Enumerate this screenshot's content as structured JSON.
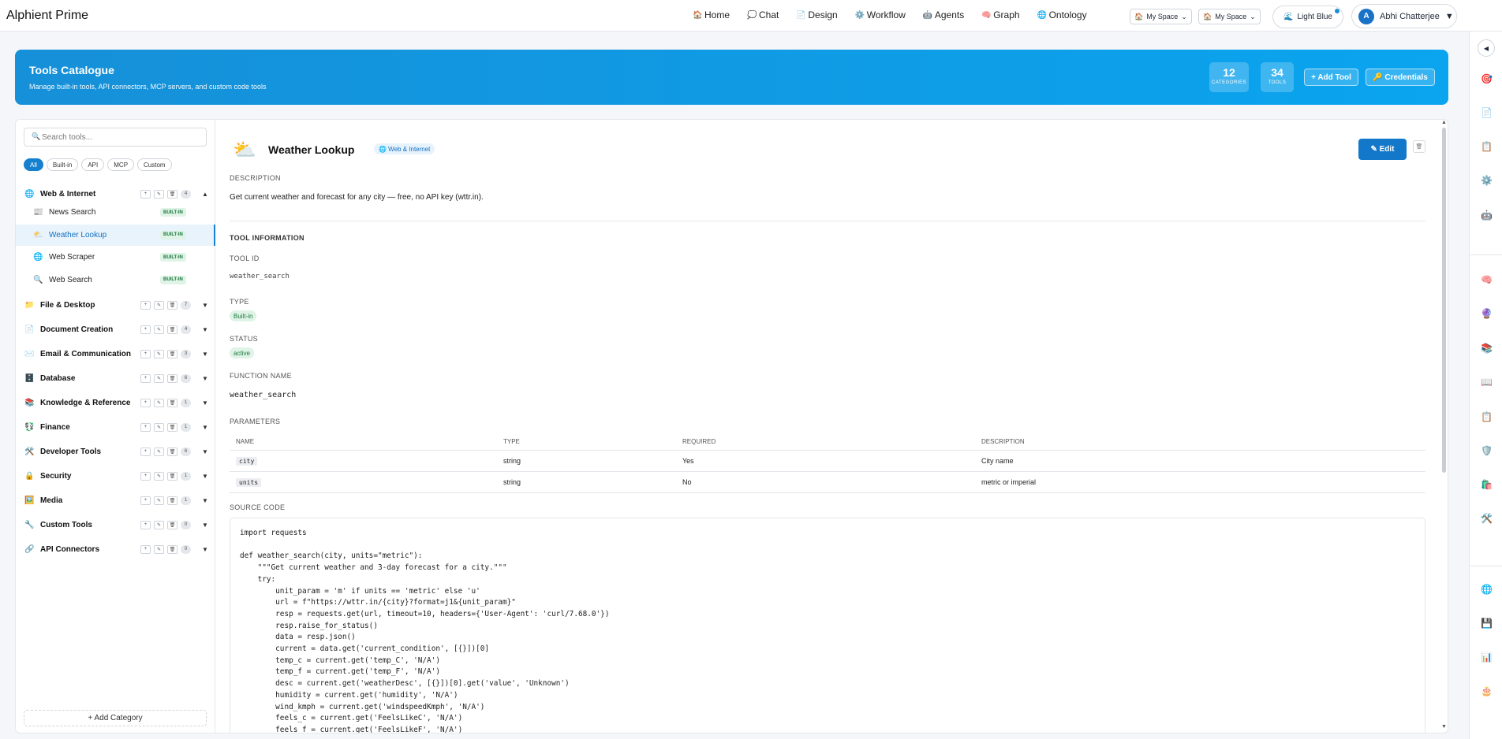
{
  "app": {
    "title": "Alphient Prime"
  },
  "nav": [
    {
      "icon": "🏠",
      "label": "Home"
    },
    {
      "icon": "💭",
      "label": "Chat"
    },
    {
      "icon": "📄",
      "label": "Design"
    },
    {
      "icon": "⚙️",
      "label": "Workflow"
    },
    {
      "icon": "🤖",
      "label": "Agents"
    },
    {
      "icon": "🧠",
      "label": "Graph"
    },
    {
      "icon": "🌐",
      "label": "Ontology"
    }
  ],
  "spaces": [
    {
      "label": "My Space"
    },
    {
      "label": "My Space"
    }
  ],
  "theme": {
    "label": "Light Blue"
  },
  "user": {
    "initial": "A",
    "name": "Abhi Chatterjee"
  },
  "header": {
    "title": "Tools Catalogue",
    "subtitle": "Manage built-in tools, API connectors, MCP servers, and custom code tools",
    "stats": [
      {
        "value": "12",
        "label": "CATEGORIES"
      },
      {
        "value": "34",
        "label": "TOOLS"
      }
    ],
    "add_tool": "+ Add Tool",
    "credentials": "🔑 Credentials"
  },
  "sidebar": {
    "search_placeholder": "Search tools...",
    "filters": [
      "All",
      "Built-in",
      "API",
      "MCP",
      "Custom"
    ],
    "categories": [
      {
        "icon": "🌐",
        "name": "Web & Internet",
        "count": "4",
        "expanded": true,
        "tools": [
          {
            "icon": "📰",
            "name": "News Search",
            "badge": "BUILT-IN"
          },
          {
            "icon": "⛅",
            "name": "Weather Lookup",
            "badge": "BUILT-IN"
          },
          {
            "icon": "🌐",
            "name": "Web Scraper",
            "badge": "BUILT-IN"
          },
          {
            "icon": "🔍",
            "name": "Web Search",
            "badge": "BUILT-IN"
          }
        ]
      },
      {
        "icon": "📁",
        "name": "File & Desktop",
        "count": "7"
      },
      {
        "icon": "📄",
        "name": "Document Creation",
        "count": "4"
      },
      {
        "icon": "✉️",
        "name": "Email & Communication",
        "count": "3"
      },
      {
        "icon": "🗄️",
        "name": "Database",
        "count": "6"
      },
      {
        "icon": "📚",
        "name": "Knowledge & Reference",
        "count": "1"
      },
      {
        "icon": "💱",
        "name": "Finance",
        "count": "1"
      },
      {
        "icon": "🛠️",
        "name": "Developer Tools",
        "count": "6"
      },
      {
        "icon": "🔒",
        "name": "Security",
        "count": "1"
      },
      {
        "icon": "🖼️",
        "name": "Media",
        "count": "1"
      },
      {
        "icon": "🔧",
        "name": "Custom Tools",
        "count": "0"
      },
      {
        "icon": "🔗",
        "name": "API Connectors",
        "count": "0"
      }
    ],
    "add_category": "+ Add Category"
  },
  "detail": {
    "icon": "⛅",
    "title": "Weather Lookup",
    "category_badge": "🌐 Web & Internet",
    "edit_label": "✎ Edit",
    "description_label": "DESCRIPTION",
    "description": "Get current weather and forecast for any city — free, no API key (wttr.in).",
    "info_label": "TOOL INFORMATION",
    "tool_id_label": "TOOL ID",
    "tool_id": "weather_search",
    "type_label": "TYPE",
    "type": "Built-in",
    "status_label": "STATUS",
    "status": "active",
    "function_label": "FUNCTION NAME",
    "function_name": "weather_search",
    "params_label": "PARAMETERS",
    "param_headers": [
      "NAME",
      "TYPE",
      "REQUIRED",
      "DESCRIPTION"
    ],
    "params": [
      {
        "name": "city",
        "type": "string",
        "required": "Yes",
        "description": "City name"
      },
      {
        "name": "units",
        "type": "string",
        "required": "No",
        "description": "metric or imperial"
      }
    ],
    "source_label": "SOURCE CODE",
    "source": "import requests\n\ndef weather_search(city, units=\"metric\"):\n    \"\"\"Get current weather and 3-day forecast for a city.\"\"\"\n    try:\n        unit_param = 'm' if units == 'metric' else 'u'\n        url = f\"https://wttr.in/{city}?format=j1&{unit_param}\"\n        resp = requests.get(url, timeout=10, headers={'User-Agent': 'curl/7.68.0'})\n        resp.raise_for_status()\n        data = resp.json()\n        current = data.get('current_condition', [{}])[0]\n        temp_c = current.get('temp_C', 'N/A')\n        temp_f = current.get('temp_F', 'N/A')\n        desc = current.get('weatherDesc', [{}])[0].get('value', 'Unknown')\n        humidity = current.get('humidity', 'N/A')\n        wind_kmph = current.get('windspeedKmph', 'N/A')\n        feels_c = current.get('FeelsLikeC', 'N/A')\n        feels_f = current.get('FeelsLikeF', 'N/A')"
  },
  "rail_icons": [
    "🎯",
    "📄",
    "📋",
    "⚙️",
    "🤖",
    "🧠",
    "🔮",
    "📚",
    "📖",
    "📋",
    "🛡️",
    "🛍️",
    "🛠️",
    "🌐",
    "💾",
    "📊",
    "🎂"
  ]
}
